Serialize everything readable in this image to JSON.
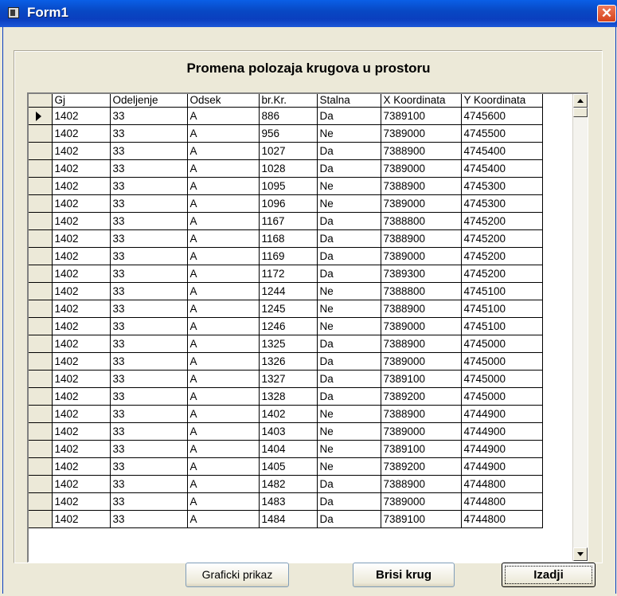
{
  "window": {
    "title": "Form1",
    "close_glyph": "✕"
  },
  "heading": "Promena polozaja krugova u prostoru",
  "grid": {
    "columns": [
      "Gj",
      "Odeljenje",
      "Odsek",
      "br.Kr.",
      "Stalna",
      "X Koordinata",
      "Y Koordinata"
    ],
    "rows": [
      [
        "1402",
        "33",
        "A",
        "886",
        "Da",
        "7389100",
        "4745600"
      ],
      [
        "1402",
        "33",
        "A",
        "956",
        "Ne",
        "7389000",
        "4745500"
      ],
      [
        "1402",
        "33",
        "A",
        "1027",
        "Da",
        "7388900",
        "4745400"
      ],
      [
        "1402",
        "33",
        "A",
        "1028",
        "Da",
        "7389000",
        "4745400"
      ],
      [
        "1402",
        "33",
        "A",
        "1095",
        "Ne",
        "7388900",
        "4745300"
      ],
      [
        "1402",
        "33",
        "A",
        "1096",
        "Ne",
        "7389000",
        "4745300"
      ],
      [
        "1402",
        "33",
        "A",
        "1167",
        "Da",
        "7388800",
        "4745200"
      ],
      [
        "1402",
        "33",
        "A",
        "1168",
        "Da",
        "7388900",
        "4745200"
      ],
      [
        "1402",
        "33",
        "A",
        "1169",
        "Da",
        "7389000",
        "4745200"
      ],
      [
        "1402",
        "33",
        "A",
        "1172",
        "Da",
        "7389300",
        "4745200"
      ],
      [
        "1402",
        "33",
        "A",
        "1244",
        "Ne",
        "7388800",
        "4745100"
      ],
      [
        "1402",
        "33",
        "A",
        "1245",
        "Ne",
        "7388900",
        "4745100"
      ],
      [
        "1402",
        "33",
        "A",
        "1246",
        "Ne",
        "7389000",
        "4745100"
      ],
      [
        "1402",
        "33",
        "A",
        "1325",
        "Da",
        "7388900",
        "4745000"
      ],
      [
        "1402",
        "33",
        "A",
        "1326",
        "Da",
        "7389000",
        "4745000"
      ],
      [
        "1402",
        "33",
        "A",
        "1327",
        "Da",
        "7389100",
        "4745000"
      ],
      [
        "1402",
        "33",
        "A",
        "1328",
        "Da",
        "7389200",
        "4745000"
      ],
      [
        "1402",
        "33",
        "A",
        "1402",
        "Ne",
        "7388900",
        "4744900"
      ],
      [
        "1402",
        "33",
        "A",
        "1403",
        "Ne",
        "7389000",
        "4744900"
      ],
      [
        "1402",
        "33",
        "A",
        "1404",
        "Ne",
        "7389100",
        "4744900"
      ],
      [
        "1402",
        "33",
        "A",
        "1405",
        "Ne",
        "7389200",
        "4744900"
      ],
      [
        "1402",
        "33",
        "A",
        "1482",
        "Da",
        "7388900",
        "4744800"
      ],
      [
        "1402",
        "33",
        "A",
        "1483",
        "Da",
        "7389000",
        "4744800"
      ],
      [
        "1402",
        "33",
        "A",
        "1484",
        "Da",
        "7389100",
        "4744800"
      ]
    ],
    "current_row": 0
  },
  "buttons": {
    "graphic_view": "Graficki prikaz",
    "delete_circle": "Brisi krug",
    "exit": "Izadji"
  }
}
